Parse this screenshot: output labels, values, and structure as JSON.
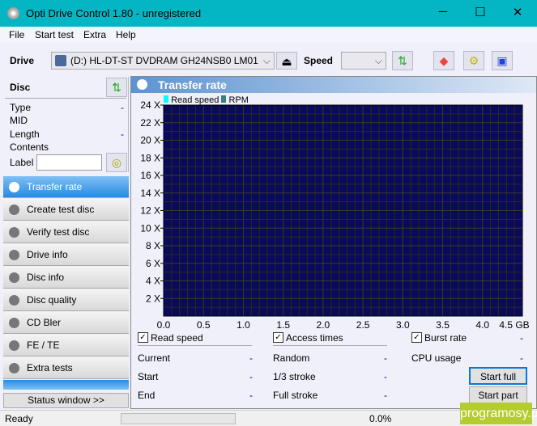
{
  "window": {
    "title": "Opti Drive Control 1.80 - unregistered",
    "icon": "disc-icon"
  },
  "menu": [
    "File",
    "Start test",
    "Extra",
    "Help"
  ],
  "toolbar": {
    "drive_label": "Drive",
    "drive_value": "(D:)  HL-DT-ST DVDRAM GH24NSB0 LM01",
    "speed_label": "Speed",
    "speed_value": ""
  },
  "disc": {
    "title": "Disc",
    "fields": [
      {
        "label": "Type",
        "value": "-"
      },
      {
        "label": "MID",
        "value": ""
      },
      {
        "label": "Length",
        "value": "-"
      },
      {
        "label": "Contents",
        "value": ""
      }
    ],
    "label_label": "Label",
    "label_value": ""
  },
  "nav": [
    "Transfer rate",
    "Create test disc",
    "Verify test disc",
    "Drive info",
    "Disc info",
    "Disc quality",
    "CD Bler",
    "FE / TE",
    "Extra tests"
  ],
  "nav_active": 0,
  "status_window": "Status window >>",
  "panel": {
    "title": "Transfer rate"
  },
  "chart_data": {
    "type": "line",
    "legend": [
      {
        "name": "Read speed",
        "color": "#00ffff"
      },
      {
        "name": "RPM",
        "color": "#3a8080"
      }
    ],
    "series": [],
    "x_ticks": [
      "0.0",
      "0.5",
      "1.0",
      "1.5",
      "2.0",
      "2.5",
      "3.0",
      "3.5",
      "4.0",
      "4.5 GB"
    ],
    "y_ticks": [
      "2 X",
      "4 X",
      "6 X",
      "8 X",
      "10 X",
      "12 X",
      "14 X",
      "16 X",
      "18 X",
      "20 X",
      "22 X",
      "24 X"
    ],
    "xlim": [
      0,
      4.5
    ],
    "ylim": [
      0,
      24
    ],
    "grid": true,
    "background": "#0a0a5a"
  },
  "stats": {
    "read_speed": {
      "label": "Read speed",
      "checked": true,
      "rows": [
        {
          "label": "Current",
          "value": "-"
        },
        {
          "label": "Start",
          "value": "-"
        },
        {
          "label": "End",
          "value": "-"
        }
      ]
    },
    "access_times": {
      "label": "Access times",
      "checked": true,
      "rows": [
        {
          "label": "Random",
          "value": "-"
        },
        {
          "label": "1/3 stroke",
          "value": "-"
        },
        {
          "label": "Full stroke",
          "value": "-"
        }
      ]
    },
    "burst_rate": {
      "label": "Burst rate",
      "checked": true,
      "value": "-"
    },
    "cpu": {
      "label": "CPU usage",
      "value": "-"
    }
  },
  "buttons": {
    "start_full": "Start full",
    "start_part": "Start part"
  },
  "statusbar": {
    "text": "Ready",
    "progress": "0.0%"
  },
  "watermark": "programosy.pl"
}
